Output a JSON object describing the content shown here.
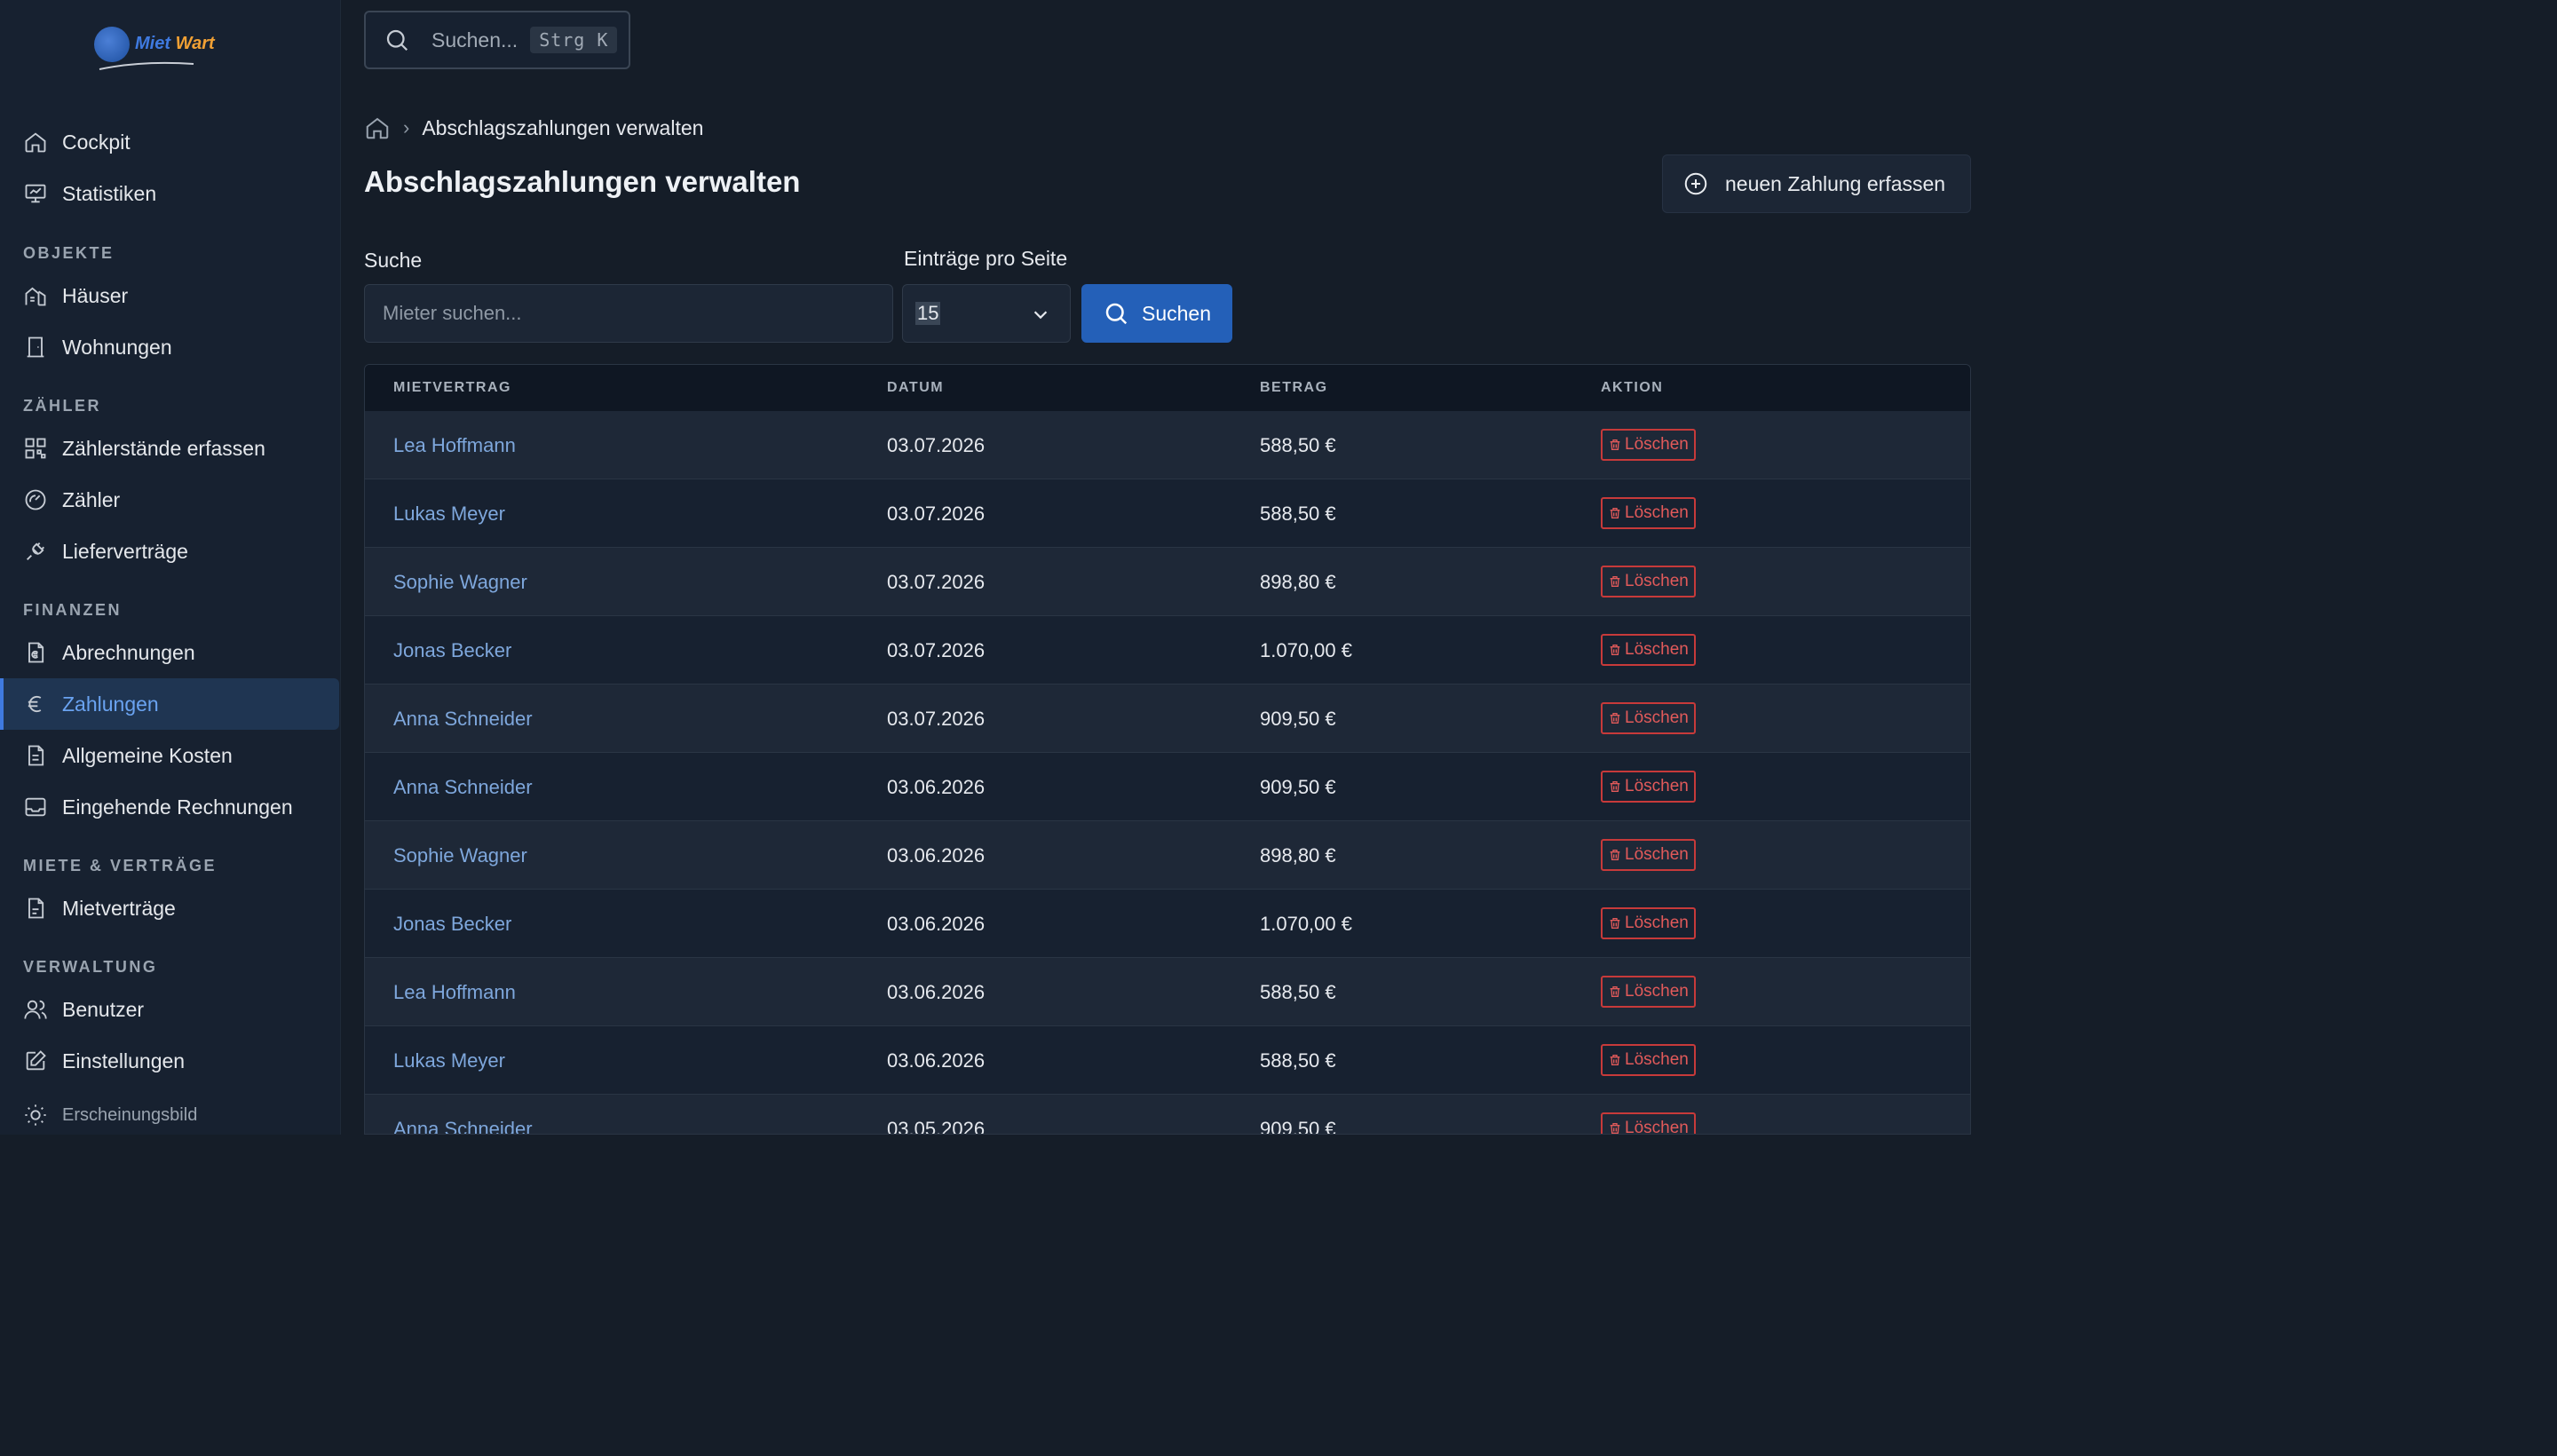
{
  "app": {
    "logo": {
      "part1": "Miet",
      "part2": "Wart"
    },
    "colors": {
      "accent": "#3f7ae0",
      "danger": "#c73a3a",
      "link": "#7ea7dc",
      "logo_orange": "#f0a034"
    }
  },
  "sidebar": {
    "items_top": [
      {
        "label": "Cockpit",
        "icon": "home-icon"
      },
      {
        "label": "Statistiken",
        "icon": "presentation-icon"
      }
    ],
    "sections": {
      "objekte": "OBJEKTE",
      "zaehler": "ZÄHLER",
      "finanzen": "FINANZEN",
      "miete": "MIETE & VERTRÄGE",
      "verwaltung": "VERWALTUNG"
    },
    "objekte": [
      {
        "label": "Häuser",
        "icon": "building-icon"
      },
      {
        "label": "Wohnungen",
        "icon": "door-icon"
      }
    ],
    "zaehler": [
      {
        "label": "Zählerstände erfassen",
        "icon": "grid-icon"
      },
      {
        "label": "Zähler",
        "icon": "gauge-icon"
      },
      {
        "label": "Lieferverträge",
        "icon": "plug-icon"
      }
    ],
    "finanzen": [
      {
        "label": "Abrechnungen",
        "icon": "invoice-euro-icon"
      },
      {
        "label": "Zahlungen",
        "icon": "euro-icon"
      },
      {
        "label": "Allgemeine Kosten",
        "icon": "document-icon"
      },
      {
        "label": "Eingehende Rechnungen",
        "icon": "inbox-icon"
      }
    ],
    "miete": [
      {
        "label": "Mietverträge",
        "icon": "contract-icon"
      }
    ],
    "verwaltung": [
      {
        "label": "Benutzer",
        "icon": "users-icon"
      },
      {
        "label": "Einstellungen",
        "icon": "edit-icon"
      }
    ],
    "appearance": {
      "label": "Erscheinungsbild",
      "icon": "sun-icon"
    }
  },
  "topbar": {
    "search_placeholder": "Suchen...",
    "shortcut": "Strg K"
  },
  "breadcrumb": {
    "current": "Abschlagszahlungen verwalten"
  },
  "page": {
    "title": "Abschlagszahlungen verwalten",
    "new_button": "neuen Zahlung erfassen"
  },
  "filters": {
    "search_label": "Suche",
    "search_placeholder": "Mieter suchen...",
    "per_page_label": "Einträge pro Seite",
    "per_page_value": "15",
    "search_button": "Suchen"
  },
  "table": {
    "headers": [
      "MIETVERTRAG",
      "DATUM",
      "BETRAG",
      "AKTION"
    ],
    "delete_label": "Löschen",
    "rows": [
      {
        "tenant": "Lea Hoffmann",
        "date": "03.07.2026",
        "amount": "588,50 €"
      },
      {
        "tenant": "Lukas Meyer",
        "date": "03.07.2026",
        "amount": "588,50 €"
      },
      {
        "tenant": "Sophie Wagner",
        "date": "03.07.2026",
        "amount": "898,80 €"
      },
      {
        "tenant": "Jonas Becker",
        "date": "03.07.2026",
        "amount": "1.070,00 €"
      },
      {
        "tenant": "Anna Schneider",
        "date": "03.07.2026",
        "amount": "909,50 €"
      },
      {
        "tenant": "Anna Schneider",
        "date": "03.06.2026",
        "amount": "909,50 €"
      },
      {
        "tenant": "Sophie Wagner",
        "date": "03.06.2026",
        "amount": "898,80 €"
      },
      {
        "tenant": "Jonas Becker",
        "date": "03.06.2026",
        "amount": "1.070,00 €"
      },
      {
        "tenant": "Lea Hoffmann",
        "date": "03.06.2026",
        "amount": "588,50 €"
      },
      {
        "tenant": "Lukas Meyer",
        "date": "03.06.2026",
        "amount": "588,50 €"
      },
      {
        "tenant": "Anna Schneider",
        "date": "03.05.2026",
        "amount": "909,50 €"
      }
    ]
  }
}
